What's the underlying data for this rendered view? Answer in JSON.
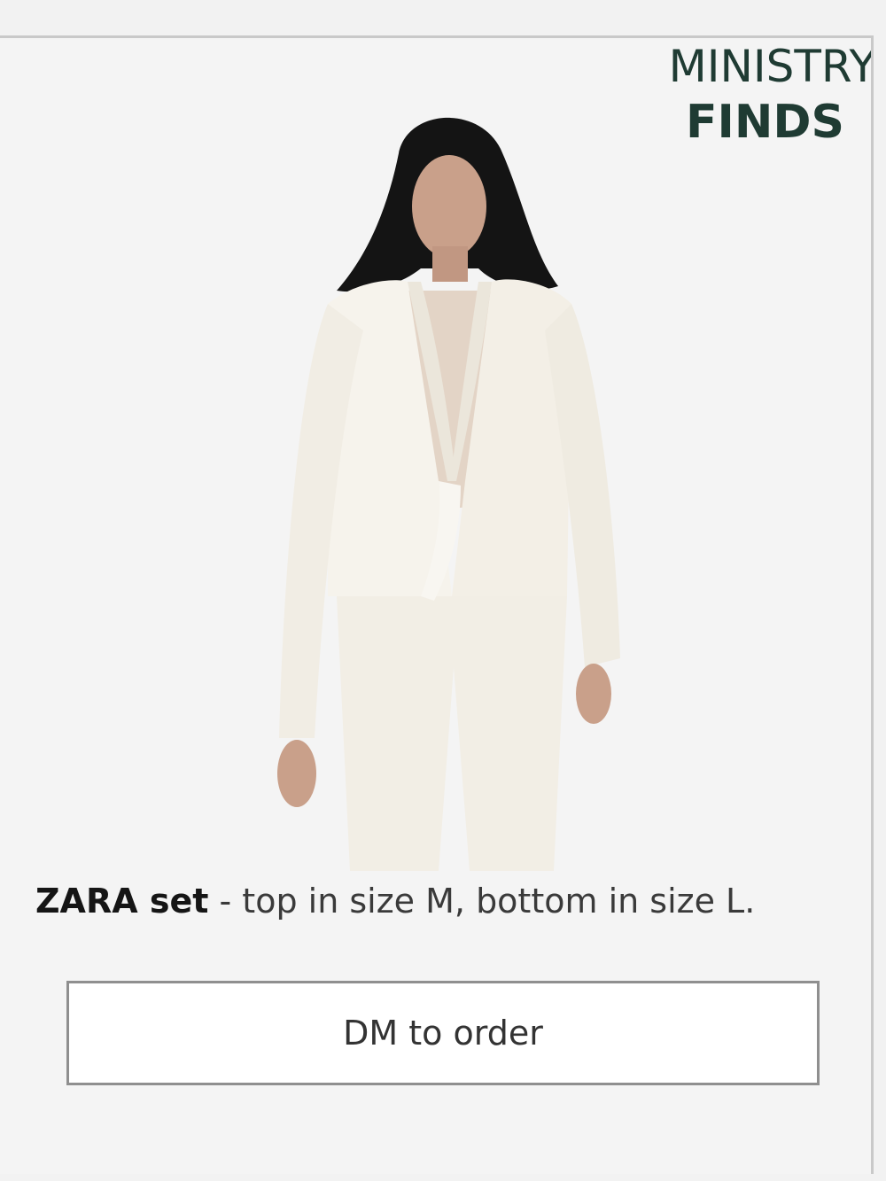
{
  "brand": {
    "line1": "MINISTRY",
    "line2": "FINDS",
    "color": "#1f3b33"
  },
  "product": {
    "caption_bold": "ZARA set",
    "caption_rest": " - top in size M, bottom in size L."
  },
  "cta": {
    "label": "DM to order"
  },
  "image": {
    "subject": "model wearing white blazer and trousers"
  }
}
